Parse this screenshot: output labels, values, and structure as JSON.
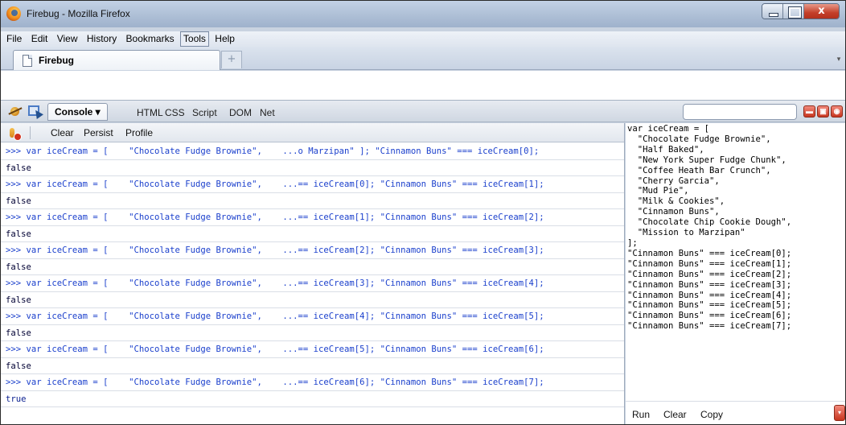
{
  "window": {
    "title": "Firebug - Mozilla Firefox",
    "minimize_glyph": "",
    "maximize_glyph": "",
    "close_glyph": "x"
  },
  "menu": {
    "file": "File",
    "edit": "Edit",
    "view": "View",
    "history": "History",
    "bookmarks": "Bookmarks",
    "tools": "Tools",
    "help": "Help"
  },
  "tabs": {
    "active_title": "Firebug",
    "new_tab_glyph": "+",
    "list_glyph": "▾"
  },
  "firebug": {
    "console_tab": "Console ▾",
    "panels": [
      "HTML",
      "CSS",
      "Script",
      "DOM",
      "Net"
    ],
    "search_placeholder": "",
    "controls": [
      "▬",
      "▣",
      "◉"
    ]
  },
  "console": {
    "clear": "Clear",
    "persist": "Persist",
    "profile": "Profile",
    "log": [
      {
        "kind": "cmd",
        "text": ">>> var iceCream = [    \"Chocolate Fudge Brownie\",    ...o Marzipan\" ]; \"Cinnamon Buns\" === iceCream[0];"
      },
      {
        "kind": "res",
        "text": "false"
      },
      {
        "kind": "cmd",
        "text": ">>> var iceCream = [    \"Chocolate Fudge Brownie\",    ...== iceCream[0]; \"Cinnamon Buns\" === iceCream[1];"
      },
      {
        "kind": "res",
        "text": "false"
      },
      {
        "kind": "cmd",
        "text": ">>> var iceCream = [    \"Chocolate Fudge Brownie\",    ...== iceCream[1]; \"Cinnamon Buns\" === iceCream[2];"
      },
      {
        "kind": "res",
        "text": "false"
      },
      {
        "kind": "cmd",
        "text": ">>> var iceCream = [    \"Chocolate Fudge Brownie\",    ...== iceCream[2]; \"Cinnamon Buns\" === iceCream[3];"
      },
      {
        "kind": "res",
        "text": "false"
      },
      {
        "kind": "cmd",
        "text": ">>> var iceCream = [    \"Chocolate Fudge Brownie\",    ...== iceCream[3]; \"Cinnamon Buns\" === iceCream[4];"
      },
      {
        "kind": "res",
        "text": "false"
      },
      {
        "kind": "cmd",
        "text": ">>> var iceCream = [    \"Chocolate Fudge Brownie\",    ...== iceCream[4]; \"Cinnamon Buns\" === iceCream[5];"
      },
      {
        "kind": "res",
        "text": "false"
      },
      {
        "kind": "cmd",
        "text": ">>> var iceCream = [    \"Chocolate Fudge Brownie\",    ...== iceCream[5]; \"Cinnamon Buns\" === iceCream[6];"
      },
      {
        "kind": "res",
        "text": "false"
      },
      {
        "kind": "cmd",
        "text": ">>> var iceCream = [    \"Chocolate Fudge Brownie\",    ...== iceCream[6]; \"Cinnamon Buns\" === iceCream[7];"
      },
      {
        "kind": "res",
        "text": "true"
      }
    ]
  },
  "editor": {
    "code_lines": [
      "var iceCream = [",
      "  \"Chocolate Fudge Brownie\",",
      "  \"Half Baked\",",
      "  \"New York Super Fudge Chunk\",",
      "  \"Coffee Heath Bar Crunch\",",
      "  \"Cherry Garcia\",",
      "  \"Mud Pie\",",
      "  \"Milk & Cookies\",",
      "  \"Cinnamon Buns\",",
      "  \"Chocolate Chip Cookie Dough\",",
      "  \"Mission to Marzipan\"",
      "];",
      "\"Cinnamon Buns\" === iceCream[0];",
      "\"Cinnamon Buns\" === iceCream[1];",
      "\"Cinnamon Buns\" === iceCream[2];",
      "\"Cinnamon Buns\" === iceCream[3];",
      "\"Cinnamon Buns\" === iceCream[4];",
      "\"Cinnamon Buns\" === iceCream[5];",
      "\"Cinnamon Buns\" === iceCream[6];",
      "\"Cinnamon Buns\" === iceCream[7];"
    ],
    "run": "Run",
    "clear": "Clear",
    "copy": "Copy",
    "scroll_glyph": "▾"
  }
}
